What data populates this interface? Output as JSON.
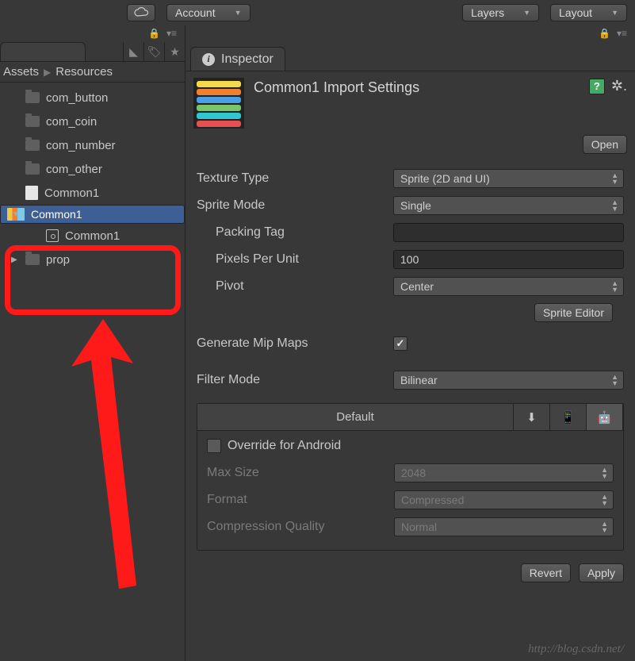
{
  "toolbar": {
    "account": "Account",
    "layers": "Layers",
    "layout": "Layout"
  },
  "project": {
    "breadcrumb_root": "Assets",
    "breadcrumb_child": "Resources"
  },
  "tree": {
    "items": [
      {
        "name": "com_button"
      },
      {
        "name": "com_coin"
      },
      {
        "name": "com_number"
      },
      {
        "name": "com_other"
      },
      {
        "name": "Common1"
      },
      {
        "name": "Common1"
      },
      {
        "name": "Common1"
      },
      {
        "name": "prop"
      }
    ]
  },
  "inspector": {
    "tab": "Inspector",
    "title": "Common1 Import Settings",
    "open": "Open",
    "props": {
      "texture_type_label": "Texture Type",
      "texture_type_value": "Sprite (2D and UI)",
      "sprite_mode_label": "Sprite Mode",
      "sprite_mode_value": "Single",
      "packing_tag_label": "Packing Tag",
      "packing_tag_value": "",
      "ppu_label": "Pixels Per Unit",
      "ppu_value": "100",
      "pivot_label": "Pivot",
      "pivot_value": "Center",
      "sprite_editor": "Sprite Editor",
      "mipmaps_label": "Generate Mip Maps",
      "mipmaps_checked": true,
      "filter_label": "Filter Mode",
      "filter_value": "Bilinear"
    },
    "platform": {
      "default_tab": "Default",
      "override_label": "Override for Android",
      "override_checked": false,
      "max_size_label": "Max Size",
      "max_size_value": "2048",
      "format_label": "Format",
      "format_value": "Compressed",
      "cq_label": "Compression Quality",
      "cq_value": "Normal"
    },
    "revert": "Revert",
    "apply": "Apply"
  },
  "watermark": "http://blog.csdn.net/"
}
